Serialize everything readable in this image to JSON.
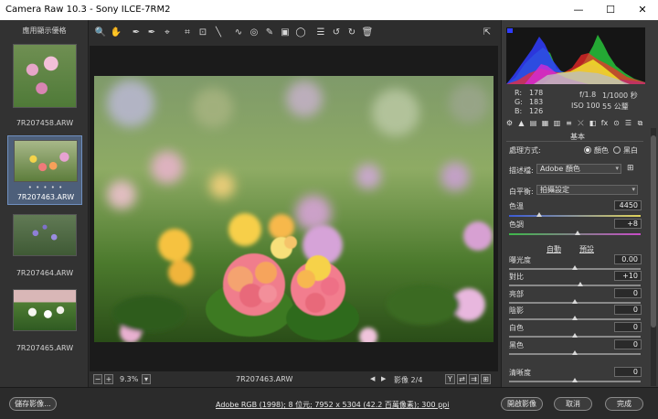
{
  "window": {
    "title": "Camera Raw 10.3  -  Sony ILCE-7RM2",
    "minimize": "—",
    "maximize": "☐",
    "close": "✕"
  },
  "filmstrip": {
    "header": "應用顯示優格",
    "items": [
      {
        "name": "7R207458.ARW"
      },
      {
        "name": "7R207463.ARW",
        "dots": "• • • • •"
      },
      {
        "name": "7R207464.ARW"
      },
      {
        "name": "7R207465.ARW"
      }
    ]
  },
  "toolbar": {
    "tools": [
      "🔍",
      "✋",
      "✒",
      "✒",
      "⌖",
      "⌗",
      "⊡",
      "╲",
      "∿",
      "◎",
      "✎",
      "▣",
      "◯",
      "☰",
      "↺",
      "↻",
      "🗑"
    ],
    "export_icon": "⇱"
  },
  "image_status": {
    "zoom_minus": "−",
    "zoom_plus": "+",
    "zoom": "9.3%",
    "filename": "7R207463.ARW",
    "prev": "◀",
    "next": "▶",
    "counter": "影像 2/4",
    "view_y": "Y",
    "view_swap": "⇄",
    "view_copy": "⇉",
    "view_settings": "⊞"
  },
  "readout": {
    "r_label": "R:",
    "g_label": "G:",
    "b_label": "B:",
    "r": "178",
    "g": "183",
    "b": "126",
    "aperture": "f/1.8",
    "shutter": "1/1000 秒",
    "iso": "ISO 100",
    "focal": "55 公釐"
  },
  "panel": {
    "section_title": "基本",
    "tab_icons": [
      "⚙",
      "▲",
      "▤",
      "▦",
      "▥",
      "≡",
      "⤫",
      "◧",
      "fx",
      "⊙",
      "☰",
      "⧉",
      "▣"
    ],
    "process_label": "處理方式:",
    "process_color": "顏色",
    "process_bw": "黑白",
    "profile_label": "描述檔:",
    "profile_value": "Adobe 顏色",
    "wb_label": "白平衡:",
    "wb_value": "拍攝設定",
    "temp_label": "色溫",
    "temp_value": "4450",
    "tint_label": "色調",
    "tint_value": "+8",
    "auto": "自動",
    "default": "預設",
    "exposure_label": "曝光度",
    "exposure_value": "0.00",
    "contrast_label": "對比",
    "contrast_value": "+10",
    "highlights_label": "亮部",
    "highlights_value": "0",
    "shadows_label": "陰影",
    "shadows_value": "0",
    "whites_label": "白色",
    "whites_value": "0",
    "blacks_label": "黑色",
    "blacks_value": "0",
    "clarity_label": "清晰度",
    "clarity_value": "0"
  },
  "bottom": {
    "save": "儲存影像...",
    "info": "Adobe RGB (1998); 8 位元; 7952 x 5304 (42.2 百萬像素); 300 ppi",
    "open": "開啟影像",
    "cancel": "取消",
    "done": "完成"
  }
}
